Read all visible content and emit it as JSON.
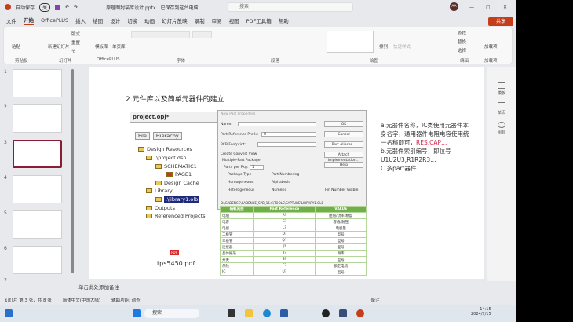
{
  "titlebar": {
    "autosave": "自动保存",
    "autosave_state": "关",
    "filename": "原理图封装库设计.pptx",
    "save_status": "已保存到这台电脑",
    "search_placeholder": "搜索",
    "user_initials": "AA"
  },
  "menu": [
    "文件",
    "开始",
    "OfficePLUS",
    "插入",
    "绘图",
    "设计",
    "切换",
    "动画",
    "幻灯片放映",
    "录制",
    "审阅",
    "视图",
    "PDF工具箱",
    "帮助"
  ],
  "share_label": "共享",
  "ribbon": {
    "groups": [
      "剪贴板",
      "幻灯片",
      "OfficePLUS",
      "字体",
      "段落",
      "绘图",
      "编辑",
      "加载项"
    ],
    "buttons": {
      "paste": "粘贴",
      "new_slide": "新建幻灯片",
      "layout": "版式",
      "reset": "重置",
      "section": "节",
      "template": "模板库",
      "single_page": "单页库",
      "arrange": "排列",
      "quick_styles": "快速样式",
      "find": "查找",
      "replace": "替换",
      "select": "选择",
      "addins": "加载项"
    }
  },
  "thumbnails": [
    "1",
    "2",
    "3",
    "4",
    "5",
    "6",
    "7"
  ],
  "active_slide": 3,
  "side_pane": [
    "模板",
    "单页",
    "图标"
  ],
  "slide": {
    "title": "2.元件库以及简单元器件的建立",
    "tree": {
      "header": "project.opj*",
      "tabs": [
        "File",
        "Hierachy"
      ],
      "nodes": [
        "Design Resources",
        ".\\project.dsn",
        "SCHEMATIC1",
        "PAGE1",
        "Design Cache",
        "Library",
        ".\\library1.olb",
        "Outputs",
        "Referenced Projects"
      ]
    },
    "dialog": {
      "title": "New Part Properties",
      "name_label": "Name:",
      "prefix_label": "Part Reference Prefix:",
      "prefix_value": "U",
      "footprint_label": "PCB Footprint:",
      "convert_label": "Create Convert View",
      "multi_label": "Multiple-Part Package",
      "parts_label": "Parts per Pkg:",
      "parts_value": "1",
      "pkg_type": "Package Type",
      "homo": "Homogeneous",
      "hetero": "Heterogeneous",
      "numbering": "Part Numbering",
      "alpha": "Alphabetic",
      "numeric": "Numeric",
      "pin_visible": "Pin Number Visible",
      "path": "D:\\CADENCE\\CADENCE_SPB_16.6\\TOOLS\\CAPTURE\\LIBRARY1.OLB",
      "buttons": [
        "OK",
        "Cancel",
        "Part Aliases...",
        "Attach Implementation...",
        "Help"
      ]
    },
    "table": {
      "headers": [
        "物料类型",
        "Part Reference",
        "VALUE"
      ],
      "rows": [
        [
          "电阻",
          "R?",
          "阻值/功率/精度"
        ],
        [
          "电容",
          "C?",
          "容值/耐压"
        ],
        [
          "电感",
          "L?",
          "电感量"
        ],
        [
          "二极管",
          "D?",
          "型号"
        ],
        [
          "三极管",
          "Q?",
          "型号"
        ],
        [
          "连接器",
          "J?",
          "型号"
        ],
        [
          "晶体振荡",
          "Y?",
          "频率"
        ],
        [
          "开关",
          "S?",
          "型号"
        ],
        [
          "保险",
          "F?",
          "额定电流"
        ],
        [
          "IC",
          "U?",
          "型号"
        ]
      ]
    },
    "notes": {
      "a": "a.元器件名称，IC类使用元器件本身名字，通用器件电阻电容使用统一名称即可，",
      "a_red": "RES,CAP…",
      "b": "b.元器件索引编号，即位号U1U2U3,R1R2R3…",
      "c": "C.多part器件"
    },
    "pdf_label": "tps5450.pdf"
  },
  "notes_placeholder": "单击此处添加备注",
  "status": {
    "slide_count": "幻灯片 第 3 张，共 8 张",
    "language": "简体中文(中国大陆)",
    "accessibility": "辅助功能: 调查",
    "notes": "备注"
  },
  "taskbar": {
    "search": "搜索",
    "time": "14:15",
    "date": "2024/7/15"
  },
  "colors": {
    "accent": "#c43e1c",
    "table_header": "#6fb04a",
    "highlight": "#d1284b"
  }
}
